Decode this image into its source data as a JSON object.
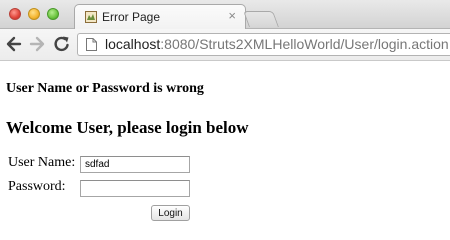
{
  "browser": {
    "tab": {
      "title": "Error Page",
      "close_glyph": "×"
    },
    "url": {
      "scheme_host": "localhost",
      "rest": ":8080/Struts2XMLHelloWorld/User/login.action"
    }
  },
  "page": {
    "error_message": "User Name or Password is wrong",
    "heading": "Welcome User, please login below",
    "form": {
      "username_label": "User Name:",
      "username_value": "sdfad",
      "password_label": "Password:",
      "password_value": "",
      "submit_label": "Login"
    }
  },
  "icons": [
    "back-arrow-icon",
    "forward-arrow-icon",
    "reload-icon",
    "page-icon",
    "favicon-icon",
    "close-icon"
  ],
  "colors": {
    "traffic_close": "#e0443a",
    "traffic_min": "#f4b52f",
    "traffic_max": "#6bc43e"
  }
}
